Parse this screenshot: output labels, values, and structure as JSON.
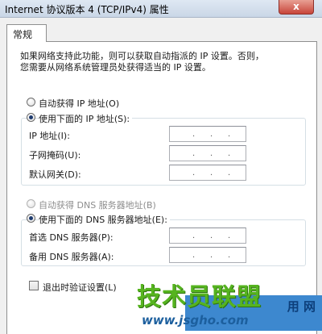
{
  "window": {
    "title": "Internet 协议版本 4 (TCP/IPv4) 属性",
    "close_label": "x"
  },
  "tabs": [
    {
      "label": "常规",
      "active": true
    }
  ],
  "description": {
    "line1": "如果网络支持此功能，则可以获取自动指派的 IP 设置。否则，",
    "line2": "您需要从网络系统管理员处获得适当的 IP 设置。"
  },
  "ip_section": {
    "auto_option": {
      "label": "自动获得 IP 地址(O)",
      "selected": false
    },
    "manual_option": {
      "label": "使用下面的 IP 地址(S):",
      "selected": true
    },
    "fields": [
      {
        "label": "IP 地址(I):",
        "value": ". . ."
      },
      {
        "label": "子网掩码(U):",
        "value": ". . ."
      },
      {
        "label": "默认网关(D):",
        "value": ". . ."
      }
    ]
  },
  "dns_section": {
    "auto_option": {
      "label": "自动获得 DNS 服务器地址(B)",
      "selected": false,
      "disabled": true
    },
    "manual_option": {
      "label": "使用下面的 DNS 服务器地址(E):",
      "selected": true
    },
    "fields": [
      {
        "label": "首选 DNS 服务器(P):",
        "value": ". . ."
      },
      {
        "label": "备用 DNS 服务器(A):",
        "value": ". . ."
      }
    ]
  },
  "validate_on_exit": {
    "label": "退出时验证设置(L)",
    "checked": false
  },
  "advanced_button": {
    "label": "用网"
  },
  "watermark": {
    "logo_text": "技术员联盟",
    "url": "www.jsgho.com",
    "net_text": "用 网"
  },
  "colors": {
    "titlebar": "#c9d6e6",
    "close_button": "#c8453a",
    "watermark_green": "#56b41f",
    "watermark_blue": "#3d88cf"
  }
}
